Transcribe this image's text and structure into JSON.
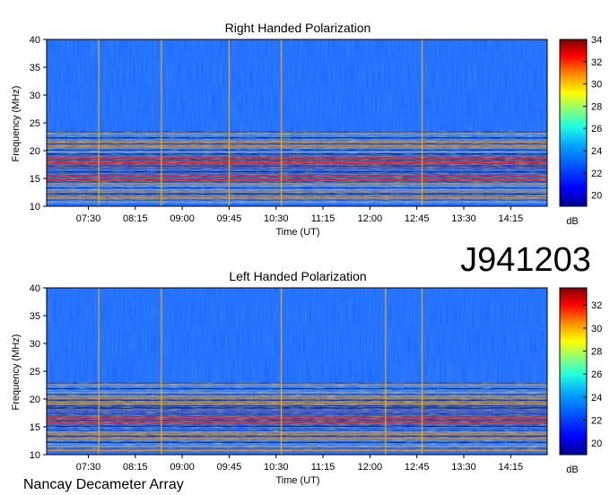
{
  "observation_id": "J941203",
  "credit": "Nancay Decameter Array",
  "colors": {
    "background_low": "#00008f",
    "background_mid": "#1060ff",
    "emission": "#d00000",
    "colormap": [
      "#00008f",
      "#0000ff",
      "#00a0ff",
      "#20ffe0",
      "#a0ff60",
      "#ffff00",
      "#ff8000",
      "#ff0000",
      "#800000"
    ]
  },
  "chart_data": [
    {
      "type": "heatmap",
      "title": "Right Handed Polarization",
      "xlabel": "Time (UT)",
      "ylabel": "Frequency (MHz)",
      "x_range": [
        "06:50",
        "14:50"
      ],
      "y_range": [
        10,
        40
      ],
      "x_ticks": [
        "07:30",
        "08:15",
        "09:00",
        "09:45",
        "10:30",
        "11:15",
        "12:00",
        "12:45",
        "13:30",
        "14:15"
      ],
      "y_ticks": [
        "10",
        "15",
        "20",
        "25",
        "30",
        "35",
        "40"
      ],
      "colorbar": {
        "label": "dB",
        "range": [
          19,
          34
        ],
        "ticks": [
          "20",
          "22",
          "24",
          "26",
          "28",
          "30",
          "32",
          "34"
        ]
      },
      "emission_bands_mhz": [
        {
          "low": 14.5,
          "high": 19.5,
          "intensity": "high"
        },
        {
          "low": 19.5,
          "high": 23.5,
          "intensity": "medium"
        },
        {
          "low": 10.5,
          "high": 14.5,
          "intensity": "medium"
        }
      ],
      "vertical_lines": [
        "07:40",
        "08:40",
        "09:45",
        "10:35",
        "12:50"
      ]
    },
    {
      "type": "heatmap",
      "title": "Left Handed Polarization",
      "xlabel": "Time (UT)",
      "ylabel": "Frequency (MHz)",
      "x_range": [
        "06:50",
        "14:50"
      ],
      "y_range": [
        10,
        40
      ],
      "x_ticks": [
        "07:30",
        "08:15",
        "09:00",
        "09:45",
        "10:30",
        "11:15",
        "12:00",
        "12:45",
        "13:30",
        "14:15"
      ],
      "y_ticks": [
        "10",
        "15",
        "20",
        "25",
        "30",
        "35",
        "40"
      ],
      "colorbar": {
        "label": "dB",
        "range": [
          19,
          33.5
        ],
        "ticks": [
          "20",
          "22",
          "24",
          "26",
          "28",
          "30",
          "32"
        ]
      },
      "emission_bands_mhz": [
        {
          "low": 14.5,
          "high": 18.5,
          "intensity": "high"
        },
        {
          "low": 18.5,
          "high": 23,
          "intensity": "medium"
        },
        {
          "low": 10.5,
          "high": 14.5,
          "intensity": "medium"
        }
      ],
      "vertical_lines": [
        "07:40",
        "08:40",
        "10:35",
        "12:15",
        "12:50"
      ]
    }
  ]
}
